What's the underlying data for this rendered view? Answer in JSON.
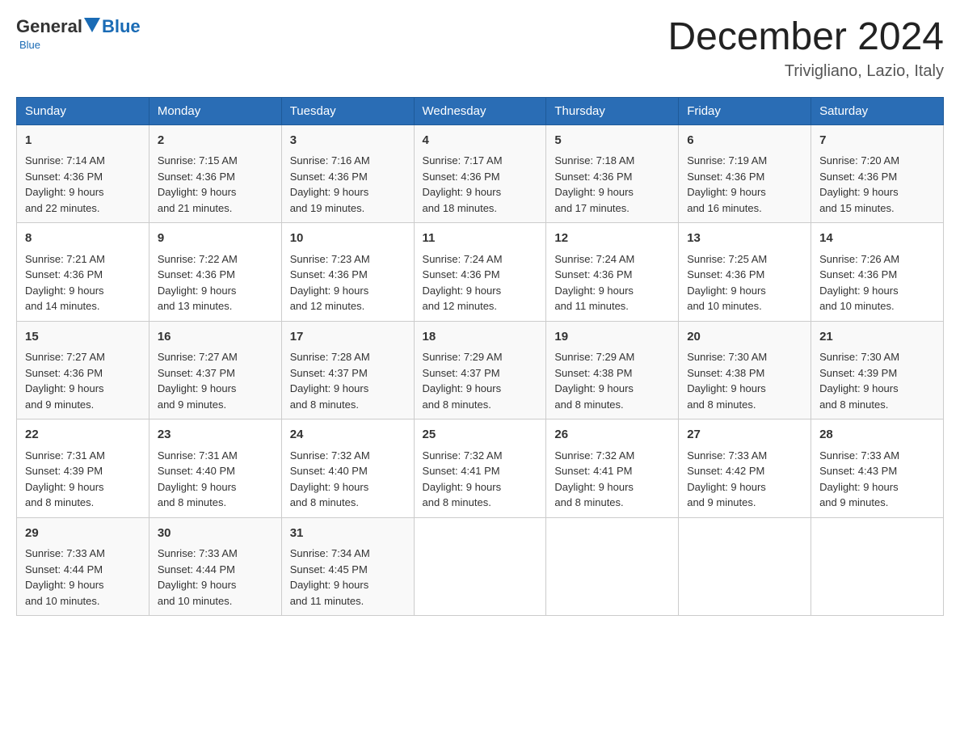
{
  "header": {
    "logo_general": "General",
    "logo_blue": "Blue",
    "month_title": "December 2024",
    "location": "Trivigliano, Lazio, Italy"
  },
  "days_of_week": [
    "Sunday",
    "Monday",
    "Tuesday",
    "Wednesday",
    "Thursday",
    "Friday",
    "Saturday"
  ],
  "weeks": [
    [
      {
        "num": "1",
        "sunrise": "7:14 AM",
        "sunset": "4:36 PM",
        "daylight": "9 hours and 22 minutes."
      },
      {
        "num": "2",
        "sunrise": "7:15 AM",
        "sunset": "4:36 PM",
        "daylight": "9 hours and 21 minutes."
      },
      {
        "num": "3",
        "sunrise": "7:16 AM",
        "sunset": "4:36 PM",
        "daylight": "9 hours and 19 minutes."
      },
      {
        "num": "4",
        "sunrise": "7:17 AM",
        "sunset": "4:36 PM",
        "daylight": "9 hours and 18 minutes."
      },
      {
        "num": "5",
        "sunrise": "7:18 AM",
        "sunset": "4:36 PM",
        "daylight": "9 hours and 17 minutes."
      },
      {
        "num": "6",
        "sunrise": "7:19 AM",
        "sunset": "4:36 PM",
        "daylight": "9 hours and 16 minutes."
      },
      {
        "num": "7",
        "sunrise": "7:20 AM",
        "sunset": "4:36 PM",
        "daylight": "9 hours and 15 minutes."
      }
    ],
    [
      {
        "num": "8",
        "sunrise": "7:21 AM",
        "sunset": "4:36 PM",
        "daylight": "9 hours and 14 minutes."
      },
      {
        "num": "9",
        "sunrise": "7:22 AM",
        "sunset": "4:36 PM",
        "daylight": "9 hours and 13 minutes."
      },
      {
        "num": "10",
        "sunrise": "7:23 AM",
        "sunset": "4:36 PM",
        "daylight": "9 hours and 12 minutes."
      },
      {
        "num": "11",
        "sunrise": "7:24 AM",
        "sunset": "4:36 PM",
        "daylight": "9 hours and 12 minutes."
      },
      {
        "num": "12",
        "sunrise": "7:24 AM",
        "sunset": "4:36 PM",
        "daylight": "9 hours and 11 minutes."
      },
      {
        "num": "13",
        "sunrise": "7:25 AM",
        "sunset": "4:36 PM",
        "daylight": "9 hours and 10 minutes."
      },
      {
        "num": "14",
        "sunrise": "7:26 AM",
        "sunset": "4:36 PM",
        "daylight": "9 hours and 10 minutes."
      }
    ],
    [
      {
        "num": "15",
        "sunrise": "7:27 AM",
        "sunset": "4:36 PM",
        "daylight": "9 hours and 9 minutes."
      },
      {
        "num": "16",
        "sunrise": "7:27 AM",
        "sunset": "4:37 PM",
        "daylight": "9 hours and 9 minutes."
      },
      {
        "num": "17",
        "sunrise": "7:28 AM",
        "sunset": "4:37 PM",
        "daylight": "9 hours and 8 minutes."
      },
      {
        "num": "18",
        "sunrise": "7:29 AM",
        "sunset": "4:37 PM",
        "daylight": "9 hours and 8 minutes."
      },
      {
        "num": "19",
        "sunrise": "7:29 AM",
        "sunset": "4:38 PM",
        "daylight": "9 hours and 8 minutes."
      },
      {
        "num": "20",
        "sunrise": "7:30 AM",
        "sunset": "4:38 PM",
        "daylight": "9 hours and 8 minutes."
      },
      {
        "num": "21",
        "sunrise": "7:30 AM",
        "sunset": "4:39 PM",
        "daylight": "9 hours and 8 minutes."
      }
    ],
    [
      {
        "num": "22",
        "sunrise": "7:31 AM",
        "sunset": "4:39 PM",
        "daylight": "9 hours and 8 minutes."
      },
      {
        "num": "23",
        "sunrise": "7:31 AM",
        "sunset": "4:40 PM",
        "daylight": "9 hours and 8 minutes."
      },
      {
        "num": "24",
        "sunrise": "7:32 AM",
        "sunset": "4:40 PM",
        "daylight": "9 hours and 8 minutes."
      },
      {
        "num": "25",
        "sunrise": "7:32 AM",
        "sunset": "4:41 PM",
        "daylight": "9 hours and 8 minutes."
      },
      {
        "num": "26",
        "sunrise": "7:32 AM",
        "sunset": "4:41 PM",
        "daylight": "9 hours and 8 minutes."
      },
      {
        "num": "27",
        "sunrise": "7:33 AM",
        "sunset": "4:42 PM",
        "daylight": "9 hours and 9 minutes."
      },
      {
        "num": "28",
        "sunrise": "7:33 AM",
        "sunset": "4:43 PM",
        "daylight": "9 hours and 9 minutes."
      }
    ],
    [
      {
        "num": "29",
        "sunrise": "7:33 AM",
        "sunset": "4:44 PM",
        "daylight": "9 hours and 10 minutes."
      },
      {
        "num": "30",
        "sunrise": "7:33 AM",
        "sunset": "4:44 PM",
        "daylight": "9 hours and 10 minutes."
      },
      {
        "num": "31",
        "sunrise": "7:34 AM",
        "sunset": "4:45 PM",
        "daylight": "9 hours and 11 minutes."
      },
      null,
      null,
      null,
      null
    ]
  ],
  "labels": {
    "sunrise": "Sunrise:",
    "sunset": "Sunset:",
    "daylight": "Daylight:"
  }
}
